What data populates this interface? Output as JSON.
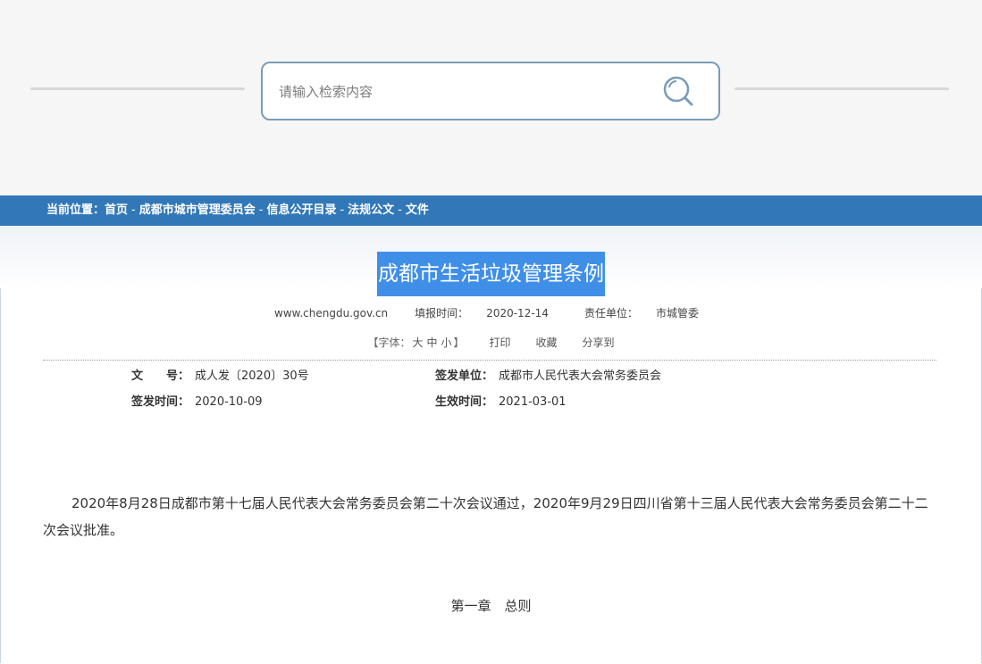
{
  "search": {
    "placeholder": "请输入检索内容"
  },
  "breadcrumb": {
    "prefix": "当前位置：",
    "items": [
      "首页",
      "成都市城市管理委员会",
      "信息公开目录",
      "法规公文",
      "文件"
    ],
    "separator": "-"
  },
  "article": {
    "title": "成都市生活垃圾管理条例",
    "source": "www.chengdu.gov.cn",
    "fill_time_label": "填报时间：",
    "fill_time": "2020-12-14",
    "responsible_label": "责任单位：",
    "responsible": "市城管委"
  },
  "tools": {
    "font_prefix": "【字体：",
    "font_large": "大",
    "font_medium": "中",
    "font_small": "小",
    "font_suffix": "】",
    "print": "打印",
    "favorite": "收藏",
    "share": "分享到"
  },
  "doc_info": {
    "doc_no_label": "文　　号：",
    "doc_no": "成人发〔2020〕30号",
    "issuer_label": "签发单位：",
    "issuer": "成都市人民代表大会常务委员会",
    "issue_date_label": "签发时间：",
    "issue_date": "2020-10-09",
    "effective_date_label": "生效时间：",
    "effective_date": "2021-03-01"
  },
  "body": {
    "intro": "2020年8月28日成都市第十七届人民代表大会常务委员会第二十次会议通过，2020年9月29日四川省第十三届人民代表大会常务委员会第二十二次会议批准。",
    "chapter": "第一章　总则"
  },
  "colors": {
    "nav_bar": "#3278b8",
    "title_highlight": "#3f8fe8",
    "search_border": "#7a9cb8"
  }
}
